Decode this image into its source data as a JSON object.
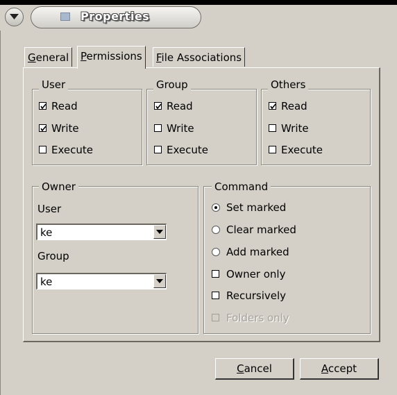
{
  "window": {
    "title": "Properties",
    "menu_icon": "chevron-down-icon",
    "title_icon": "folder-icon"
  },
  "tabs": [
    {
      "mnemonic": "G",
      "rest": "eneral",
      "active": false
    },
    {
      "mnemonic": "P",
      "rest": "ermissions",
      "active": true
    },
    {
      "mnemonic": "F",
      "rest": "ile Associations",
      "active": false
    }
  ],
  "permissions": {
    "user": {
      "title": "User",
      "read": "Read",
      "write": "Write",
      "execute": "Execute",
      "read_checked": true,
      "write_checked": true,
      "execute_checked": false
    },
    "group": {
      "title": "Group",
      "read": "Read",
      "write": "Write",
      "execute": "Execute",
      "read_checked": true,
      "write_checked": false,
      "execute_checked": false
    },
    "others": {
      "title": "Others",
      "read": "Read",
      "write": "Write",
      "execute": "Execute",
      "read_checked": true,
      "write_checked": false,
      "execute_checked": false
    }
  },
  "owner": {
    "title": "Owner",
    "user_label": "User",
    "user_value": "ke",
    "group_label": "Group",
    "group_value": "ke"
  },
  "command": {
    "title": "Command",
    "set_marked": "Set marked",
    "clear_marked": "Clear marked",
    "add_marked": "Add marked",
    "owner_only": "Owner only",
    "recursively": "Recursively",
    "folders_only": "Folders only",
    "selected": "set_marked"
  },
  "buttons": {
    "cancel_mnemonic": "C",
    "cancel_rest": "ancel",
    "accept_mnemonic": "A",
    "accept_rest": "ccept"
  }
}
